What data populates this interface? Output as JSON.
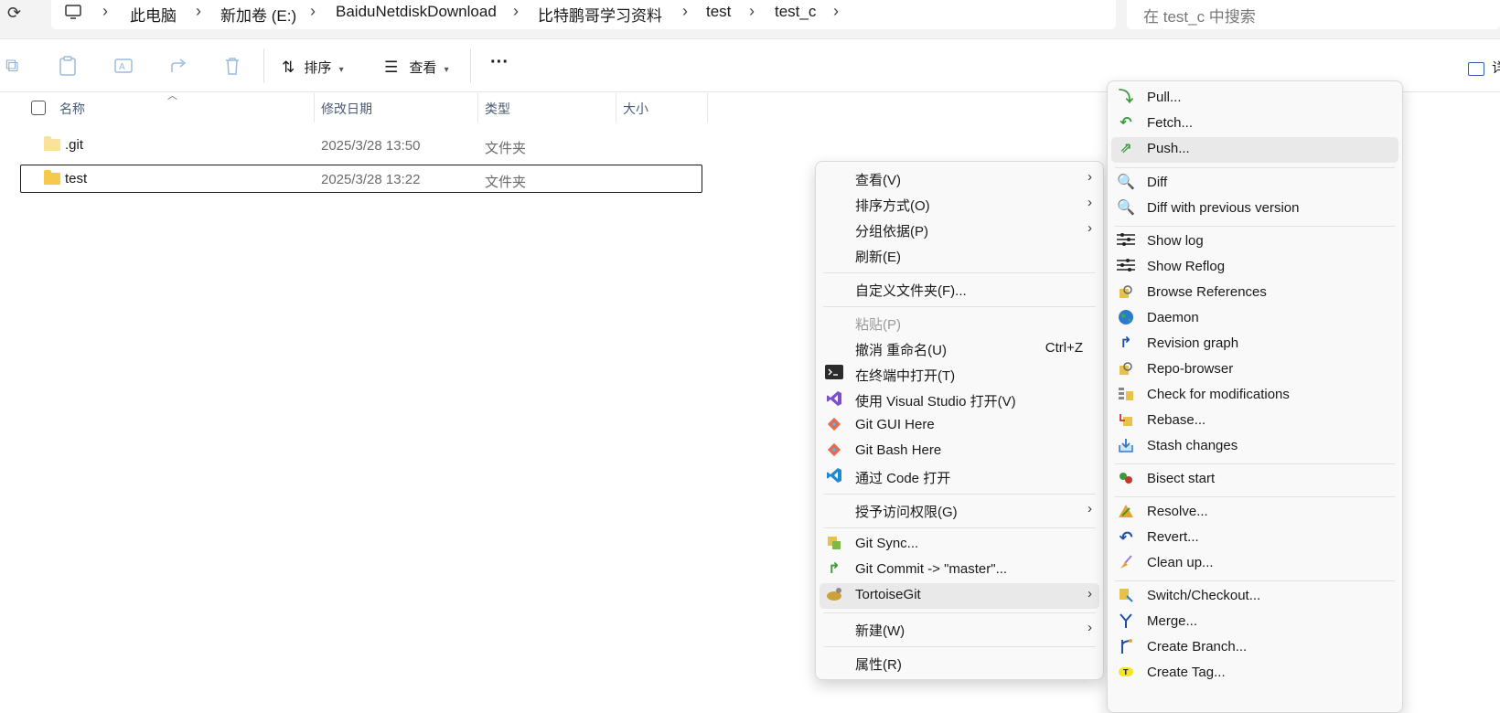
{
  "addressbar": {
    "crumbs": [
      "此电脑",
      "新加卷 (E:)",
      "BaiduNetdiskDownload",
      "比特鹏哥学习资料",
      "test",
      "test_c"
    ],
    "separator": "›",
    "search_placeholder": "在 test_c 中搜索"
  },
  "toolbar": {
    "sort_label": "排序",
    "view_label": "查看",
    "more_label": "···",
    "details_label": "详"
  },
  "columns": [
    "名称",
    "修改日期",
    "类型",
    "大小"
  ],
  "files": [
    {
      "name": ".git",
      "date": "2025/3/28 13:50",
      "type": "文件夹",
      "size": ""
    },
    {
      "name": "test",
      "date": "2025/3/28 13:22",
      "type": "文件夹",
      "size": ""
    }
  ],
  "context_menu": {
    "items": [
      {
        "label": "查看(V)",
        "icon": "",
        "submenu": true
      },
      {
        "label": "排序方式(O)",
        "icon": "",
        "submenu": true
      },
      {
        "label": "分组依据(P)",
        "icon": "",
        "submenu": true
      },
      {
        "label": "刷新(E)",
        "icon": ""
      },
      {
        "label": "自定义文件夹(F)...",
        "icon": ""
      },
      {
        "label": "粘贴(P)",
        "icon": "",
        "disabled": true
      },
      {
        "label": "撤消 重命名(U)",
        "icon": "",
        "shortcut": "Ctrl+Z"
      },
      {
        "label": "在终端中打开(T)",
        "icon": "terminal-icon"
      },
      {
        "label": "使用 Visual Studio 打开(V)",
        "icon": "visual-studio-icon"
      },
      {
        "label": "Git GUI Here",
        "icon": "git-icon"
      },
      {
        "label": "Git Bash Here",
        "icon": "git-icon"
      },
      {
        "label": "通过 Code 打开",
        "icon": "vscode-icon"
      },
      {
        "label": "授予访问权限(G)",
        "icon": "",
        "submenu": true
      },
      {
        "label": "Git Sync...",
        "icon": "git-sync-icon"
      },
      {
        "label": "Git Commit -> \"master\"...",
        "icon": "git-commit-icon"
      },
      {
        "label": "TortoiseGit",
        "icon": "tortoisegit-icon",
        "submenu": true,
        "highlighted": true
      },
      {
        "label": "新建(W)",
        "icon": "",
        "submenu": true
      },
      {
        "label": "属性(R)",
        "icon": ""
      }
    ]
  },
  "tortoise_menu": {
    "items": [
      {
        "label": "Pull...",
        "icon": "pull-icon"
      },
      {
        "label": "Fetch...",
        "icon": "fetch-icon"
      },
      {
        "label": "Push...",
        "icon": "push-icon",
        "highlighted": true
      },
      {
        "label": "Diff",
        "icon": "diff-icon"
      },
      {
        "label": "Diff with previous version",
        "icon": "diff-icon"
      },
      {
        "label": "Show log",
        "icon": "log-icon"
      },
      {
        "label": "Show Reflog",
        "icon": "log-icon"
      },
      {
        "label": "Browse References",
        "icon": "references-icon"
      },
      {
        "label": "Daemon",
        "icon": "globe-icon"
      },
      {
        "label": "Revision graph",
        "icon": "revision-graph-icon"
      },
      {
        "label": "Repo-browser",
        "icon": "repo-browser-icon"
      },
      {
        "label": "Check for modifications",
        "icon": "check-modifications-icon"
      },
      {
        "label": "Rebase...",
        "icon": "rebase-icon"
      },
      {
        "label": "Stash changes",
        "icon": "stash-icon"
      },
      {
        "label": "Bisect start",
        "icon": "bisect-icon"
      },
      {
        "label": "Resolve...",
        "icon": "resolve-icon"
      },
      {
        "label": "Revert...",
        "icon": "revert-icon"
      },
      {
        "label": "Clean up...",
        "icon": "cleanup-icon"
      },
      {
        "label": "Switch/Checkout...",
        "icon": "switch-icon"
      },
      {
        "label": "Merge...",
        "icon": "merge-icon"
      },
      {
        "label": "Create Branch...",
        "icon": "branch-icon"
      },
      {
        "label": "Create Tag...",
        "icon": "tag-icon"
      }
    ]
  },
  "colors": {
    "accent": "#2f6bd0",
    "highlight": "#e9e9e9",
    "folder": "#f6c94c"
  }
}
